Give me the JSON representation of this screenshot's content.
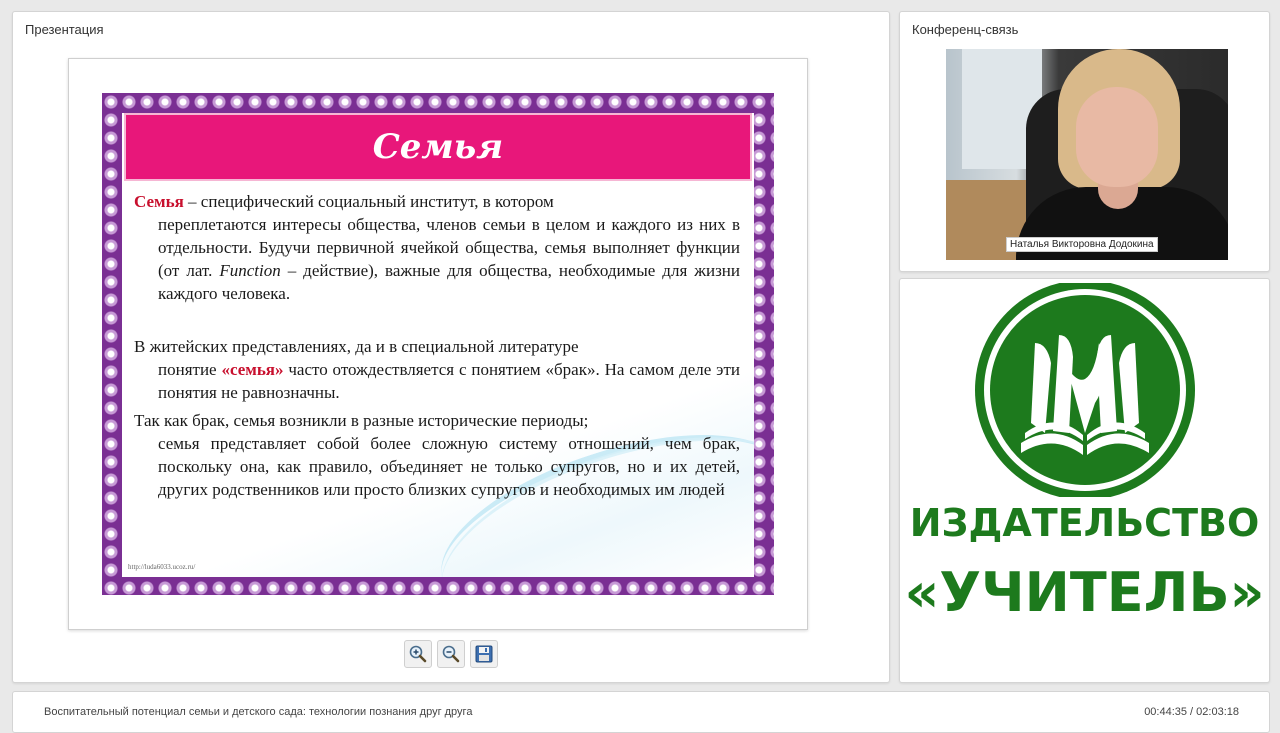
{
  "presentation": {
    "title": "Презентация",
    "slide": {
      "title": "Семья",
      "p1_term": "Семья",
      "p1_first": " – специфический социальный институт, в котором",
      "p1_rest": "переплетаются интересы общества, членов семьи в целом и каждого из них в отдельности. Будучи первичной ячейкой общества, семья выполняет функции (от лат. ",
      "p1_italic": "Function",
      "p1_end": " – действие), важные для общества, необходимые для жизни каждого человека.",
      "p2_first": " В житейских представлениях, да и в специальной литературе",
      "p2_pre": "понятие ",
      "p2_term": "«семья»",
      "p2_rest": " часто отождествляется с понятием «брак». На самом деле эти понятия не равнозначны.",
      "p3_first": "Так как брак,  семья возникли в разные исторические периоды;",
      "p3_rest": "семья представляет собой более сложную систему отношений, чем брак, поскольку она, как правило, объединяет не только супругов, но и их детей, других родственников или просто близких супругов и необходимых им людей",
      "url": "http://luda6033.ucoz.ru/"
    },
    "toolbar": {
      "zoom_in_icon": "zoom-in-icon",
      "zoom_out_icon": "zoom-out-icon",
      "save_icon": "floppy-disk-icon"
    }
  },
  "conference": {
    "title": "Конференц-связь",
    "speaker_name": "Наталья Викторовна Додокина"
  },
  "logo": {
    "line1": "ИЗДАТЕЛЬСТВО",
    "line2": "«УЧИТЕЛЬ»",
    "color": "#1d7a1d"
  },
  "footer": {
    "course_title": "Воспитательный потенциал семьи и детского сада: технологии познания друг друга",
    "timer": "00:44:35 / 02:03:18"
  }
}
